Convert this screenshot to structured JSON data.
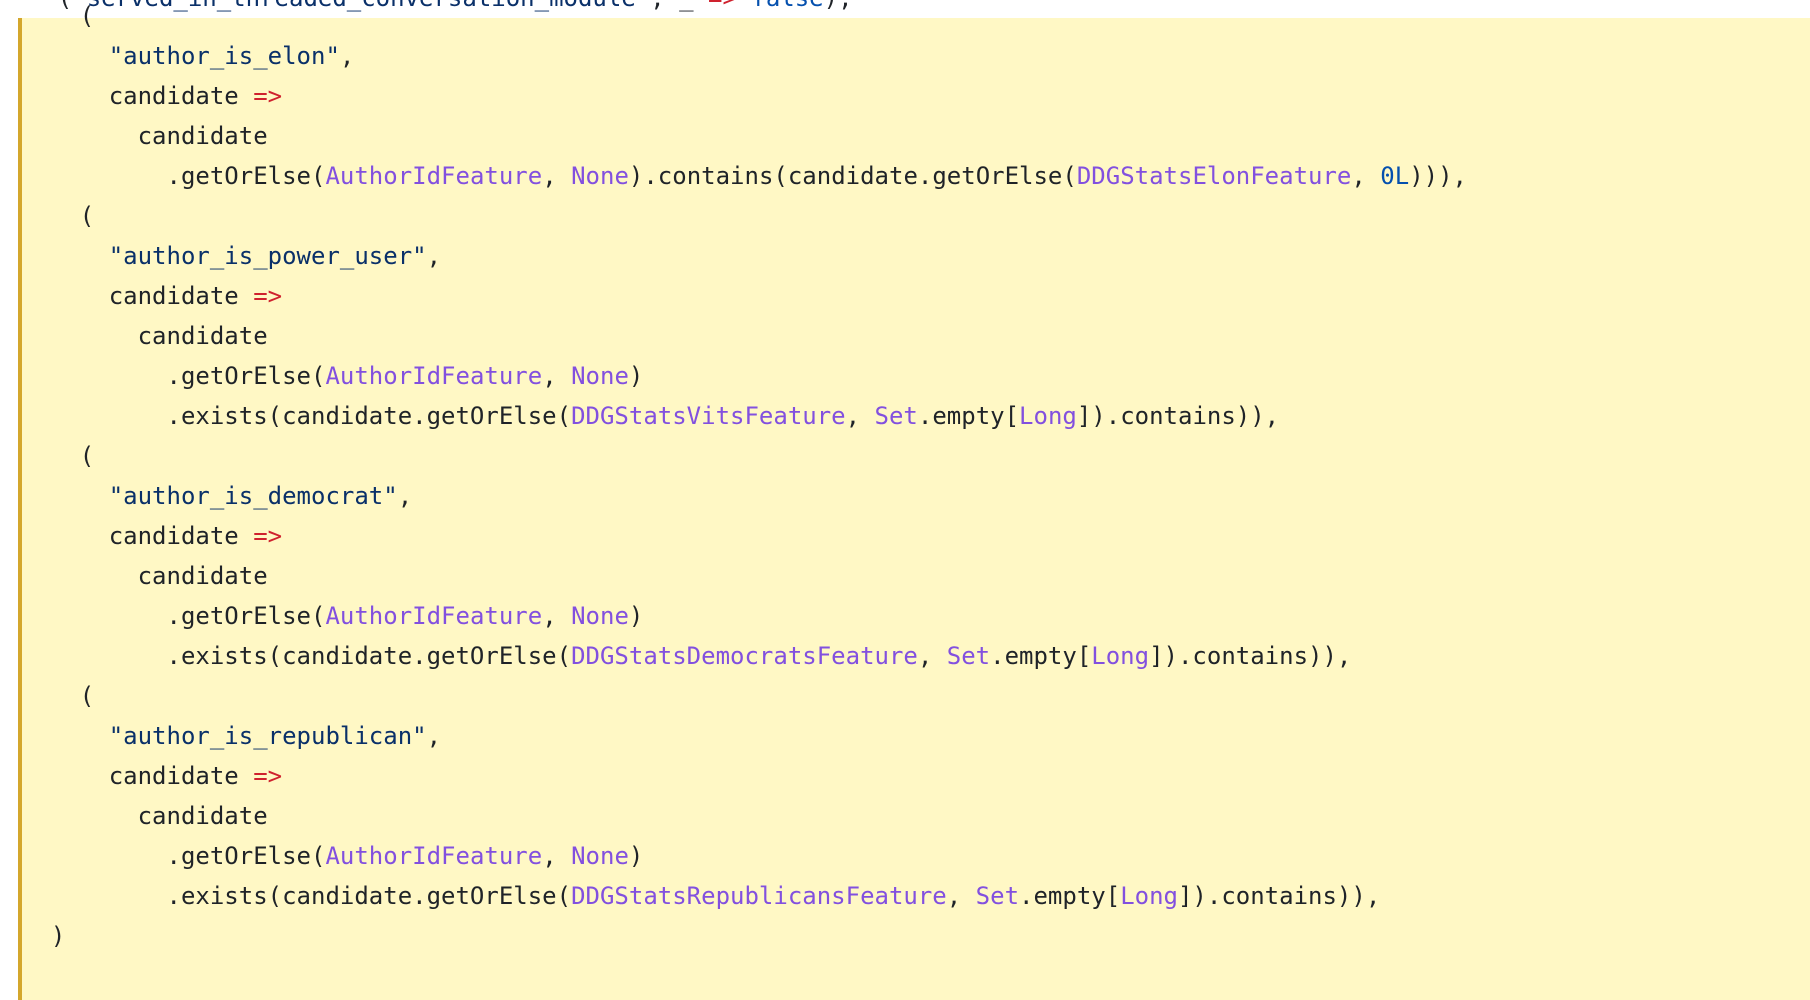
{
  "code": {
    "partial_top_line": {
      "indent": "    ",
      "tokens": [
        {
          "t": "(",
          "k": "plain"
        },
        {
          "t": "\"served_in_threaded_conversation_module\"",
          "k": "str"
        },
        {
          "t": ", _ ",
          "k": "plain"
        },
        {
          "t": "=>",
          "k": "op"
        },
        {
          "t": " false",
          "k": "num"
        },
        {
          "t": "),",
          "k": "plain"
        }
      ]
    },
    "lines": [
      {
        "indent": "    ",
        "tokens": [
          {
            "t": "(",
            "k": "plain"
          }
        ]
      },
      {
        "indent": "      ",
        "tokens": [
          {
            "t": "\"author_is_elon\"",
            "k": "str"
          },
          {
            "t": ",",
            "k": "plain"
          }
        ]
      },
      {
        "indent": "      ",
        "tokens": [
          {
            "t": "candidate ",
            "k": "plain"
          },
          {
            "t": "=>",
            "k": "op"
          }
        ]
      },
      {
        "indent": "        ",
        "tokens": [
          {
            "t": "candidate",
            "k": "plain"
          }
        ]
      },
      {
        "indent": "          ",
        "tokens": [
          {
            "t": ".getOrElse(",
            "k": "plain"
          },
          {
            "t": "AuthorIdFeature",
            "k": "type"
          },
          {
            "t": ", ",
            "k": "plain"
          },
          {
            "t": "None",
            "k": "type"
          },
          {
            "t": ").contains(candidate.getOrElse(",
            "k": "plain"
          },
          {
            "t": "DDGStatsElonFeature",
            "k": "type"
          },
          {
            "t": ", ",
            "k": "plain"
          },
          {
            "t": "0L",
            "k": "num"
          },
          {
            "t": "))),",
            "k": "plain"
          }
        ]
      },
      {
        "indent": "    ",
        "tokens": [
          {
            "t": "(",
            "k": "plain"
          }
        ]
      },
      {
        "indent": "      ",
        "tokens": [
          {
            "t": "\"author_is_power_user\"",
            "k": "str"
          },
          {
            "t": ",",
            "k": "plain"
          }
        ]
      },
      {
        "indent": "      ",
        "tokens": [
          {
            "t": "candidate ",
            "k": "plain"
          },
          {
            "t": "=>",
            "k": "op"
          }
        ]
      },
      {
        "indent": "        ",
        "tokens": [
          {
            "t": "candidate",
            "k": "plain"
          }
        ]
      },
      {
        "indent": "          ",
        "tokens": [
          {
            "t": ".getOrElse(",
            "k": "plain"
          },
          {
            "t": "AuthorIdFeature",
            "k": "type"
          },
          {
            "t": ", ",
            "k": "plain"
          },
          {
            "t": "None",
            "k": "type"
          },
          {
            "t": ")",
            "k": "plain"
          }
        ]
      },
      {
        "indent": "          ",
        "tokens": [
          {
            "t": ".exists(candidate.getOrElse(",
            "k": "plain"
          },
          {
            "t": "DDGStatsVitsFeature",
            "k": "type"
          },
          {
            "t": ", ",
            "k": "plain"
          },
          {
            "t": "Set",
            "k": "type"
          },
          {
            "t": ".empty[",
            "k": "plain"
          },
          {
            "t": "Long",
            "k": "type"
          },
          {
            "t": "]).contains)),",
            "k": "plain"
          }
        ]
      },
      {
        "indent": "    ",
        "tokens": [
          {
            "t": "(",
            "k": "plain"
          }
        ]
      },
      {
        "indent": "      ",
        "tokens": [
          {
            "t": "\"author_is_democrat\"",
            "k": "str"
          },
          {
            "t": ",",
            "k": "plain"
          }
        ]
      },
      {
        "indent": "      ",
        "tokens": [
          {
            "t": "candidate ",
            "k": "plain"
          },
          {
            "t": "=>",
            "k": "op"
          }
        ]
      },
      {
        "indent": "        ",
        "tokens": [
          {
            "t": "candidate",
            "k": "plain"
          }
        ]
      },
      {
        "indent": "          ",
        "tokens": [
          {
            "t": ".getOrElse(",
            "k": "plain"
          },
          {
            "t": "AuthorIdFeature",
            "k": "type"
          },
          {
            "t": ", ",
            "k": "plain"
          },
          {
            "t": "None",
            "k": "type"
          },
          {
            "t": ")",
            "k": "plain"
          }
        ]
      },
      {
        "indent": "          ",
        "tokens": [
          {
            "t": ".exists(candidate.getOrElse(",
            "k": "plain"
          },
          {
            "t": "DDGStatsDemocratsFeature",
            "k": "type"
          },
          {
            "t": ", ",
            "k": "plain"
          },
          {
            "t": "Set",
            "k": "type"
          },
          {
            "t": ".empty[",
            "k": "plain"
          },
          {
            "t": "Long",
            "k": "type"
          },
          {
            "t": "]).contains)),",
            "k": "plain"
          }
        ]
      },
      {
        "indent": "    ",
        "tokens": [
          {
            "t": "(",
            "k": "plain"
          }
        ]
      },
      {
        "indent": "      ",
        "tokens": [
          {
            "t": "\"author_is_republican\"",
            "k": "str"
          },
          {
            "t": ",",
            "k": "plain"
          }
        ]
      },
      {
        "indent": "      ",
        "tokens": [
          {
            "t": "candidate ",
            "k": "plain"
          },
          {
            "t": "=>",
            "k": "op"
          }
        ]
      },
      {
        "indent": "        ",
        "tokens": [
          {
            "t": "candidate",
            "k": "plain"
          }
        ]
      },
      {
        "indent": "          ",
        "tokens": [
          {
            "t": ".getOrElse(",
            "k": "plain"
          },
          {
            "t": "AuthorIdFeature",
            "k": "type"
          },
          {
            "t": ", ",
            "k": "plain"
          },
          {
            "t": "None",
            "k": "type"
          },
          {
            "t": ")",
            "k": "plain"
          }
        ]
      },
      {
        "indent": "          ",
        "tokens": [
          {
            "t": ".exists(candidate.getOrElse(",
            "k": "plain"
          },
          {
            "t": "DDGStatsRepublicansFeature",
            "k": "type"
          },
          {
            "t": ", ",
            "k": "plain"
          },
          {
            "t": "Set",
            "k": "type"
          },
          {
            "t": ".empty[",
            "k": "plain"
          },
          {
            "t": "Long",
            "k": "type"
          },
          {
            "t": "]).contains)),",
            "k": "plain"
          }
        ]
      },
      {
        "indent": "  ",
        "tokens": [
          {
            "t": ")",
            "k": "plain"
          }
        ]
      }
    ]
  },
  "colors": {
    "highlight_background": "#fff8c5",
    "highlight_border": "#d4a72c",
    "plain": "#1f2328",
    "string": "#0a3069",
    "operator": "#cf222e",
    "type": "#8250df",
    "number": "#0550ae"
  }
}
